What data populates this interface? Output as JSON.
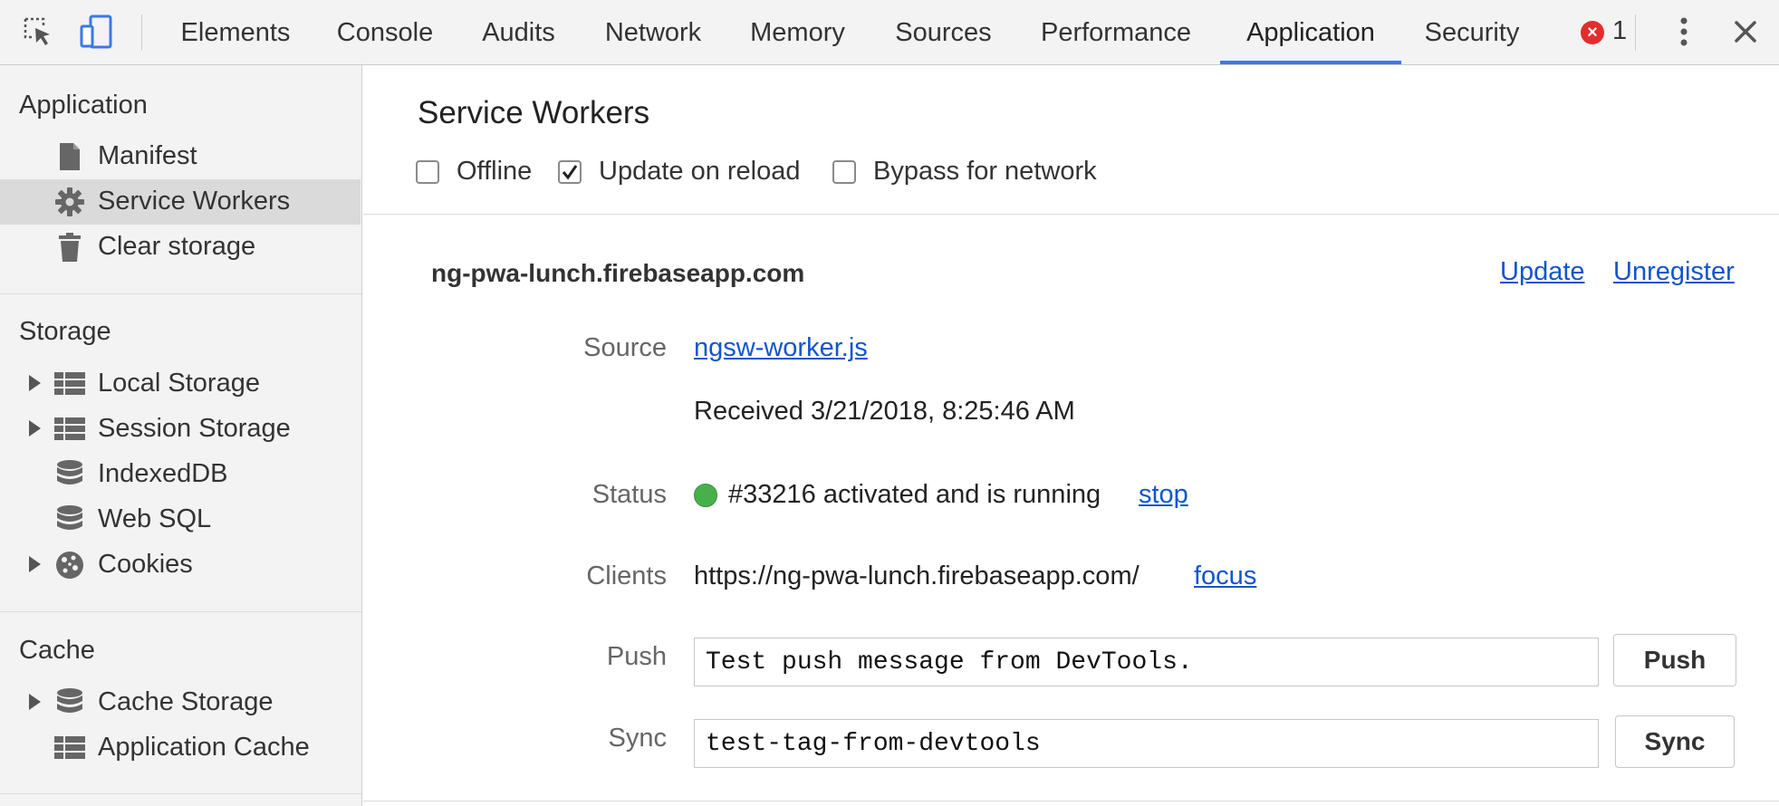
{
  "toolbar": {
    "tabs": [
      "Elements",
      "Console",
      "Audits",
      "Network",
      "Memory",
      "Sources",
      "Performance",
      "Application",
      "Security"
    ],
    "active_tab": "Application",
    "error_count": "1",
    "icons": [
      "inspect-element-icon",
      "device-toolbar-icon",
      "error-icon",
      "more-options-icon",
      "close-icon"
    ]
  },
  "sidebar": {
    "application": {
      "title": "Application",
      "items": [
        {
          "label": "Manifest",
          "icon": "manifest-icon"
        },
        {
          "label": "Service Workers",
          "icon": "gear-icon",
          "selected": true
        },
        {
          "label": "Clear storage",
          "icon": "trash-icon"
        }
      ]
    },
    "storage": {
      "title": "Storage",
      "items": [
        {
          "label": "Local Storage",
          "icon": "grid-icon",
          "expandable": true
        },
        {
          "label": "Session Storage",
          "icon": "grid-icon",
          "expandable": true
        },
        {
          "label": "IndexedDB",
          "icon": "database-icon"
        },
        {
          "label": "Web SQL",
          "icon": "database-icon"
        },
        {
          "label": "Cookies",
          "icon": "cookie-icon",
          "expandable": true
        }
      ]
    },
    "cache": {
      "title": "Cache",
      "items": [
        {
          "label": "Cache Storage",
          "icon": "database-icon",
          "expandable": true
        },
        {
          "label": "Application Cache",
          "icon": "grid-icon"
        }
      ]
    }
  },
  "main": {
    "title": "Service Workers",
    "options": [
      {
        "label": "Offline",
        "checked": false
      },
      {
        "label": "Update on reload",
        "checked": true
      },
      {
        "label": "Bypass for network",
        "checked": false
      }
    ],
    "origin": "ng-pwa-lunch.firebaseapp.com",
    "actions": {
      "update": "Update",
      "unregister": "Unregister"
    },
    "source": {
      "label": "Source",
      "link": "ngsw-worker.js",
      "received": "Received 3/21/2018, 8:25:46 AM"
    },
    "status": {
      "label": "Status",
      "text": "#33216 activated and is running",
      "action": "stop",
      "color": "#47b04b"
    },
    "clients": {
      "label": "Clients",
      "url": "https://ng-pwa-lunch.firebaseapp.com/",
      "action": "focus"
    },
    "push": {
      "label": "Push",
      "value": "Test push message from DevTools.",
      "button": "Push"
    },
    "sync": {
      "label": "Sync",
      "value": "test-tag-from-devtools",
      "button": "Sync"
    }
  }
}
